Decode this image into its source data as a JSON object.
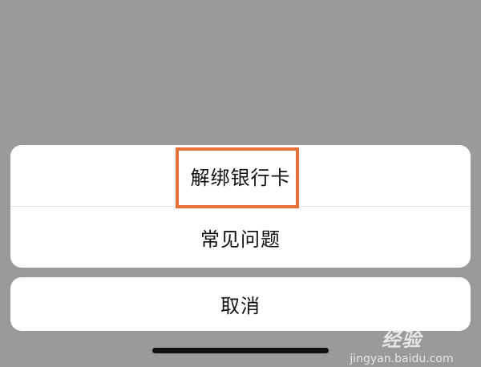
{
  "action_sheet": {
    "items": [
      {
        "label": "解绑银行卡"
      },
      {
        "label": "常见问题"
      }
    ],
    "cancel_label": "取消"
  },
  "watermark": {
    "brand": "Baidu经验",
    "url": "jingyan.baidu.com"
  },
  "colors": {
    "overlay": "#9a9a9a",
    "sheet": "#ffffff",
    "highlight": "#e8703a",
    "text": "#111111"
  }
}
